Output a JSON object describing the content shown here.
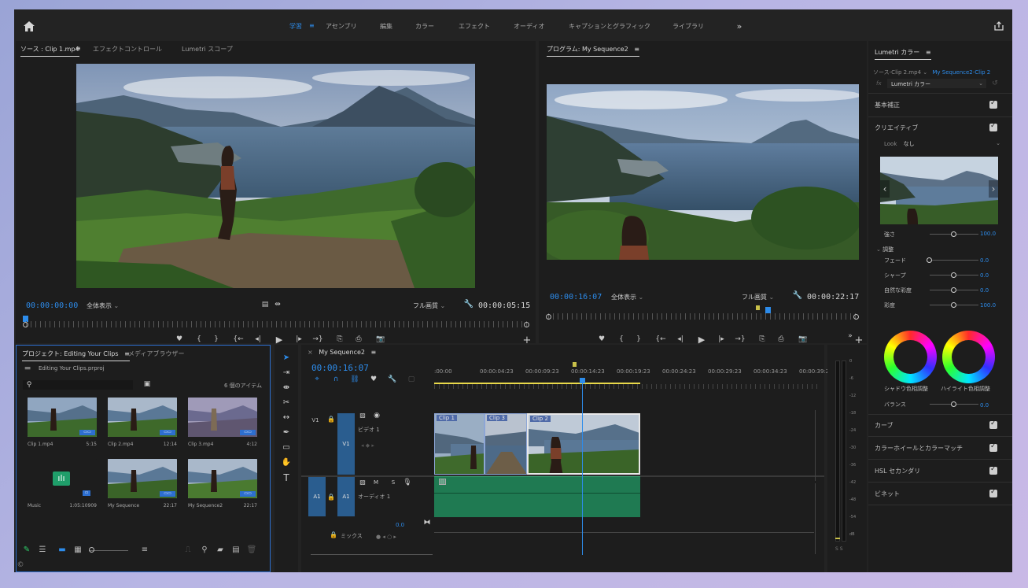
{
  "topbar": {
    "workspaces": [
      "学習",
      "アセンブリ",
      "編集",
      "カラー",
      "エフェクト",
      "オーディオ",
      "キャプションとグラフィック",
      "ライブラリ"
    ],
    "active_workspace": "学習",
    "menu_glyph": "≡",
    "more_glyph": "»"
  },
  "source": {
    "tabs": [
      "ソース : Clip 1.mp4",
      "エフェクトコントロール",
      "Lumetri スコープ"
    ],
    "menu_glyph": "≡",
    "timecode": "00:00:00:00",
    "zoom": "全体表示",
    "quality": "フル画質",
    "duration": "00:00:05:15"
  },
  "program": {
    "title": "プログラム: My Sequence2",
    "menu_glyph": "≡",
    "timecode": "00:00:16:07",
    "zoom": "全体表示",
    "quality": "フル画質",
    "duration": "00:00:22:17"
  },
  "lumetri": {
    "title": "Lumetri カラー",
    "menu_glyph": "≡",
    "source_clip": "ソース-Clip 2.mp4",
    "sequence_clip": "My Sequence2-Clip 2",
    "fx_label": "fx",
    "effect": "Lumetri カラー",
    "basic": "基本補正",
    "creative": "クリエイティブ",
    "look_label": "Look",
    "look_value": "なし",
    "intensity_label": "強さ",
    "intensity_value": "100.0",
    "adjust": "調整",
    "fade_label": "フェード",
    "fade_value": "0.0",
    "sharpen_label": "シャープ",
    "sharpen_value": "0.0",
    "vibrance_label": "自然な彩度",
    "vibrance_value": "0.0",
    "saturation_label": "彩度",
    "saturation_value": "100.0",
    "shadow_tint": "シャドウ色相調整",
    "highlight_tint": "ハイライト色相調整",
    "balance_label": "バランス",
    "balance_value": "0.0",
    "curves": "カーブ",
    "color_wheels": "カラーホイールとカラーマッチ",
    "hsl": "HSL セカンダリ",
    "vignette": "ビネット",
    "intensity_fraction": 0.5,
    "fade_fraction": 0.0,
    "sharpen_fraction": 0.5,
    "vibrance_fraction": 0.5,
    "saturation_fraction": 0.5,
    "balance_fraction": 0.5
  },
  "project": {
    "tab": "プロジェクト: Editing Your Clips",
    "menu_glyph": "≡",
    "media_tab": "メディアブラウザー",
    "file": "Editing Your Clips.prproj",
    "items_count": "6 個のアイテム",
    "items": [
      {
        "name": "Clip 1.mp4",
        "duration": "5:15"
      },
      {
        "name": "Clip 2.mp4",
        "duration": "12:14"
      },
      {
        "name": "Clip 3.mp4",
        "duration": "4:12"
      },
      {
        "name": "Music",
        "duration": "1:05:10909"
      },
      {
        "name": "My Sequence",
        "duration": "22:17"
      },
      {
        "name": "My Sequence2",
        "duration": "22:17"
      }
    ]
  },
  "timeline": {
    "sequence": "My Sequence2",
    "menu_glyph": "≡",
    "close_glyph": "×",
    "timecode": "00:00:16:07",
    "ruler": [
      ":00:00",
      "00:00:04:23",
      "00:00:09:23",
      "00:00:14:23",
      "00:00:19:23",
      "00:00:24:23",
      "00:00:29:23",
      "00:00:34:23",
      "00:00:39:23"
    ],
    "video_track": {
      "source": "V1",
      "target": "V1",
      "name": "ビデオ 1"
    },
    "audio_track": {
      "source": "A1",
      "target": "A1",
      "name": "オーディオ 1",
      "mute": "M",
      "solo": "S"
    },
    "mix_label": "ミックス",
    "mix_value": "0.0",
    "clips": [
      "Clip 1",
      "Clip 3",
      "Clip 2"
    ]
  },
  "meter": {
    "scale": [
      "0",
      "-6",
      "-12",
      "-18",
      "-24",
      "-30",
      "-36",
      "-42",
      "-48",
      "-54",
      "dB"
    ],
    "solo_label": "S S"
  },
  "colors": {
    "accent": "#2d8ceb",
    "panel": "#1d1d1d",
    "audio_clip": "#1f7a52",
    "work_area": "#e9d94a"
  }
}
